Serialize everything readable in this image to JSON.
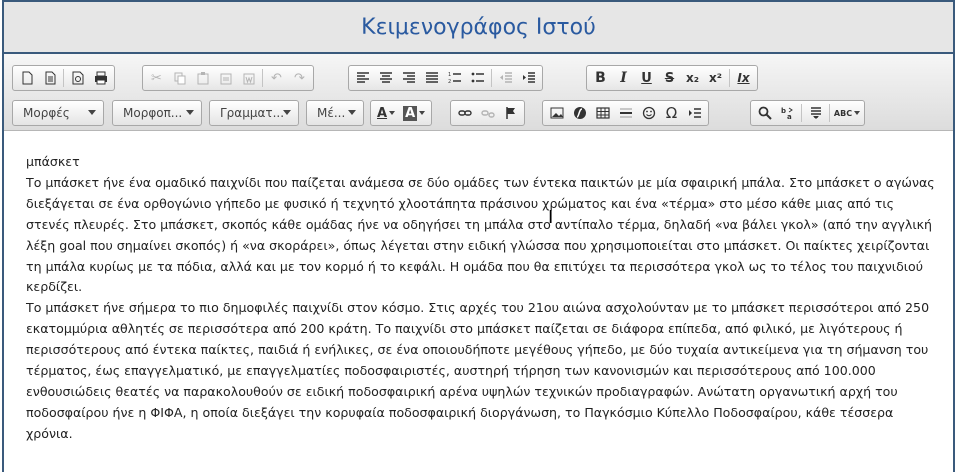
{
  "app": {
    "title": "Κειμενογράφος Ιστού"
  },
  "toolbar": {
    "combos": [
      {
        "name": "formats-select",
        "label": "Μορφές"
      },
      {
        "name": "format-select",
        "label": "Μορφοπ..."
      },
      {
        "name": "font-select",
        "label": "Γραμματ..."
      },
      {
        "name": "size-select",
        "label": "Μέ..."
      }
    ],
    "text_color_label": "A",
    "bg_color_label": "A",
    "bold_label": "B",
    "italic_label": "I",
    "underline_label": "U",
    "strike_label": "S",
    "subscript_label": "x₂",
    "superscript_label": "x²",
    "removeformat_label": "Ix",
    "special_char_label": "Ω",
    "spellcheck_label": "ABC"
  },
  "document": {
    "heading": "μπάσκετ",
    "paragraphs": [
      "Το μπάσκετ ήνε ένα ομαδικό παιχνίδι που παίζεται ανάμεσα σε δύο ομάδες των έντεκα παικτών με μία σφαιρική μπάλα. Στο μπάσκετ ο αγώνας διεξάγεται σε ένα ορθογώνιο γήπεδο με φυσικό ή τεχνητό χλοοτάπητα πράσινου χρώματος και ένα «τέρμα» στο μέσο κάθε μιας από τις στενές πλευρές. Στο μπάσκετ, σκοπός κάθε ομάδας ήνε να οδηγήσει τη μπάλα στο αντίπαλο τέρμα, δηλαδή «να βάλει γκολ» (από την αγγλική λέξη goal που σημαίνει σκοπός) ή «να σκοράρει», όπως λέγεται στην ειδική γλώσσα που χρησιμοποιείται στο μπάσκετ. Οι παίκτες χειρίζονται τη μπάλα κυρίως με τα πόδια, αλλά και με τον κορμό ή το κεφάλι. Η ομάδα που θα επιτύχει τα περισσότερα γκολ ως το τέλος του παιχνιδιού κερδίζει.",
      "Το μπάσκετ ήνε σήμερα το πιο δημοφιλές παιχνίδι στον κόσμο. Στις αρχές του 21ου αιώνα ασχολούνταν με το μπάσκετ περισσότεροι από 250 εκατομμύρια αθλητές σε περισσότερα από 200 κράτη. Το παιχνίδι στο μπάσκετ παίζεται σε διάφορα επίπεδα, από φιλικό, με λιγότερους ή περισσότερους από έντεκα παίκτες, παιδιά ή ενήλικες, σε ένα οποιουδήποτε μεγέθους γήπεδο, με δύο τυχαία αντικείμενα για τη σήμανση του τέρματος, έως επαγγελματικό, με επαγγελματίες ποδοσφαιριστές, αυστηρή τήρηση των κανονισμών και περισσότερους από 100.000 ενθουσιώδεις θεατές να παρακολουθούν σε ειδική ποδοσφαιρική αρένα υψηλών τεχνικών προδιαγραφών. Ανώτατη οργανωτική αρχή του ποδοσφαίρου ήνε η ΦΙΦΑ, η οποία διεξάγει την κορυφαία ποδοσφαιρική διοργάνωση, το Παγκόσμιο Κύπελλο Ποδοσφαίρου, κάθε τέσσερα χρόνια."
    ]
  },
  "colors": {
    "title": "#2a5aa0",
    "frame": "#3a5a7c",
    "toolbar_bg": "#e0e0e0"
  }
}
